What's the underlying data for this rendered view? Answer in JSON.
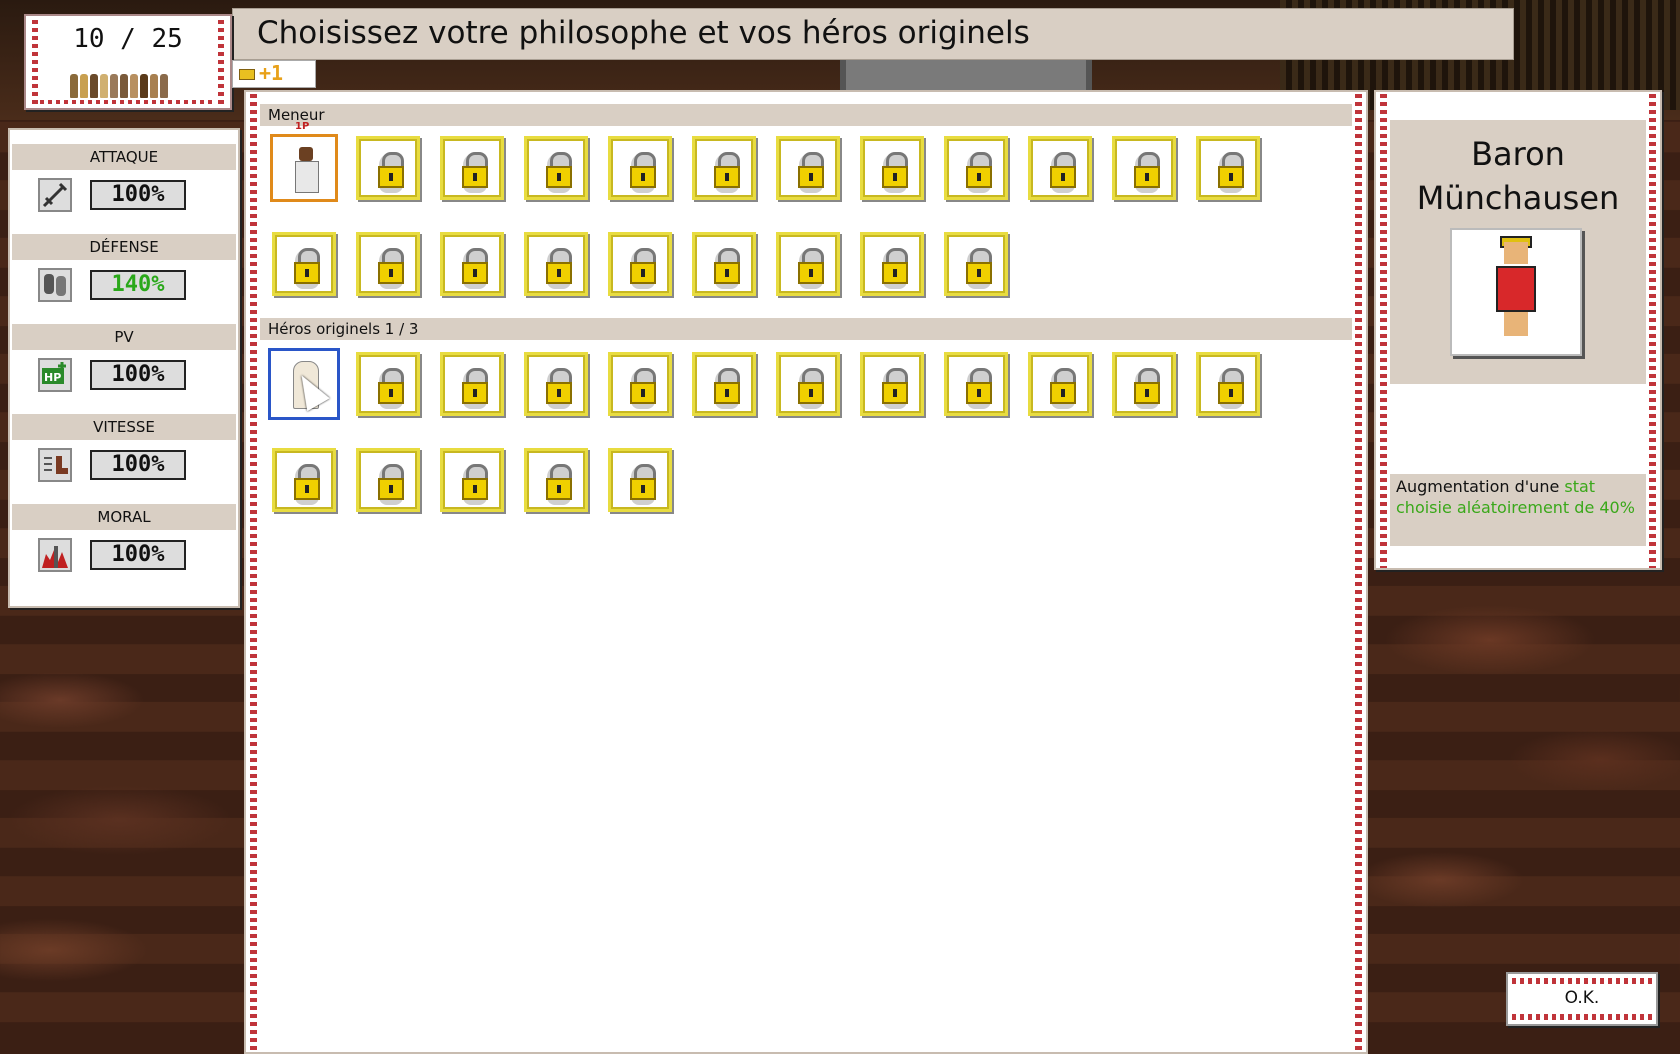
{
  "header": {
    "counter": "10 / 25",
    "title": "Choisissez votre philosophe et vos héros originels",
    "bonus": "+1"
  },
  "stats": [
    {
      "label": "ATTAQUE",
      "value": "100%",
      "icon": "sword-icon",
      "color": "#111111"
    },
    {
      "label": "DÉFENSE",
      "value": "140%",
      "icon": "shield-icon",
      "color": "#2aa81a"
    },
    {
      "label": "PV",
      "value": "100%",
      "icon": "hp-icon",
      "color": "#111111"
    },
    {
      "label": "VITESSE",
      "value": "100%",
      "icon": "boot-icon",
      "color": "#111111"
    },
    {
      "label": "MORAL",
      "value": "100%",
      "icon": "morale-icon",
      "color": "#111111"
    }
  ],
  "sections": {
    "leader": {
      "label": "Meneur",
      "slots_total": 21,
      "unlocked": 1,
      "badge": "1P"
    },
    "heroes": {
      "label": "Héros originels 1 / 3",
      "slots_total": 17,
      "unlocked": 1
    }
  },
  "detail": {
    "name_line1": "Baron",
    "name_line2": "Münchausen",
    "desc_prefix": "Augmentation d'une ",
    "desc_highlight": "stat choisie aléatoirement de 40%"
  },
  "ok_button": "O.K."
}
